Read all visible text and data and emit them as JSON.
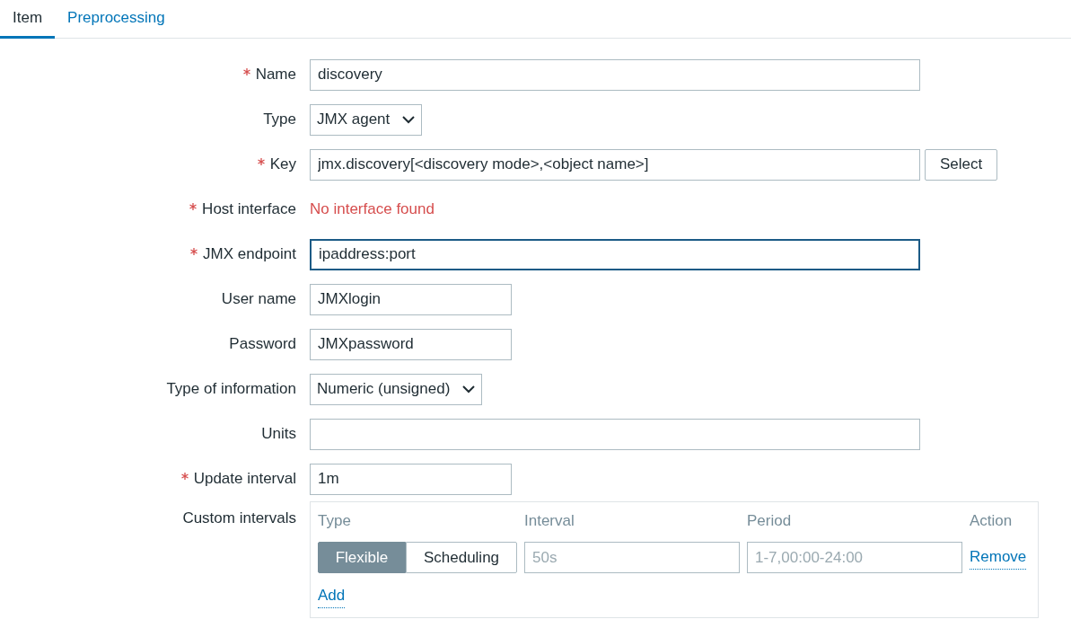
{
  "tabs": [
    {
      "label": "Item",
      "selected": true
    },
    {
      "label": "Preprocessing",
      "selected": false
    }
  ],
  "form": [
    {
      "kind": "text",
      "label": "Name",
      "required": true,
      "value": "discovery",
      "focused": false
    },
    {
      "kind": "select",
      "label": "Type",
      "required": false,
      "value": "JMX agent"
    },
    {
      "kind": "text-button",
      "label": "Key",
      "required": true,
      "value": "jmx.discovery[<discovery mode>,<object name>]",
      "focused": false,
      "button": "Select"
    },
    {
      "kind": "message",
      "label": "Host interface",
      "required": true,
      "value": "No interface found"
    },
    {
      "kind": "text",
      "label": "JMX endpoint",
      "required": true,
      "value": "ipaddress:port",
      "focused": true
    },
    {
      "kind": "short-text",
      "label": "User name",
      "required": false,
      "value": "JMXlogin",
      "focused": false
    },
    {
      "kind": "short-text",
      "label": "Password",
      "required": false,
      "value": "JMXpassword",
      "focused": false
    },
    {
      "kind": "select",
      "label": "Type of information",
      "required": false,
      "value": "Numeric (unsigned)"
    },
    {
      "kind": "text",
      "label": "Units",
      "required": false,
      "focused": false
    },
    {
      "kind": "short-text",
      "label": "Update interval",
      "required": true,
      "value": "1m",
      "focused": false
    },
    {
      "kind": "intervals",
      "label": "Custom intervals",
      "required": false,
      "columns": [
        "Type",
        "Interval",
        "Period",
        "Action"
      ],
      "rows": [
        {
          "modes": [
            {
              "label": "Flexible",
              "selected": true
            },
            {
              "label": "Scheduling",
              "selected": false
            }
          ],
          "interval_placeholder": "50s",
          "period_placeholder": "1-7,00:00-24:00",
          "action": "Remove"
        }
      ],
      "add": "Add"
    }
  ]
}
